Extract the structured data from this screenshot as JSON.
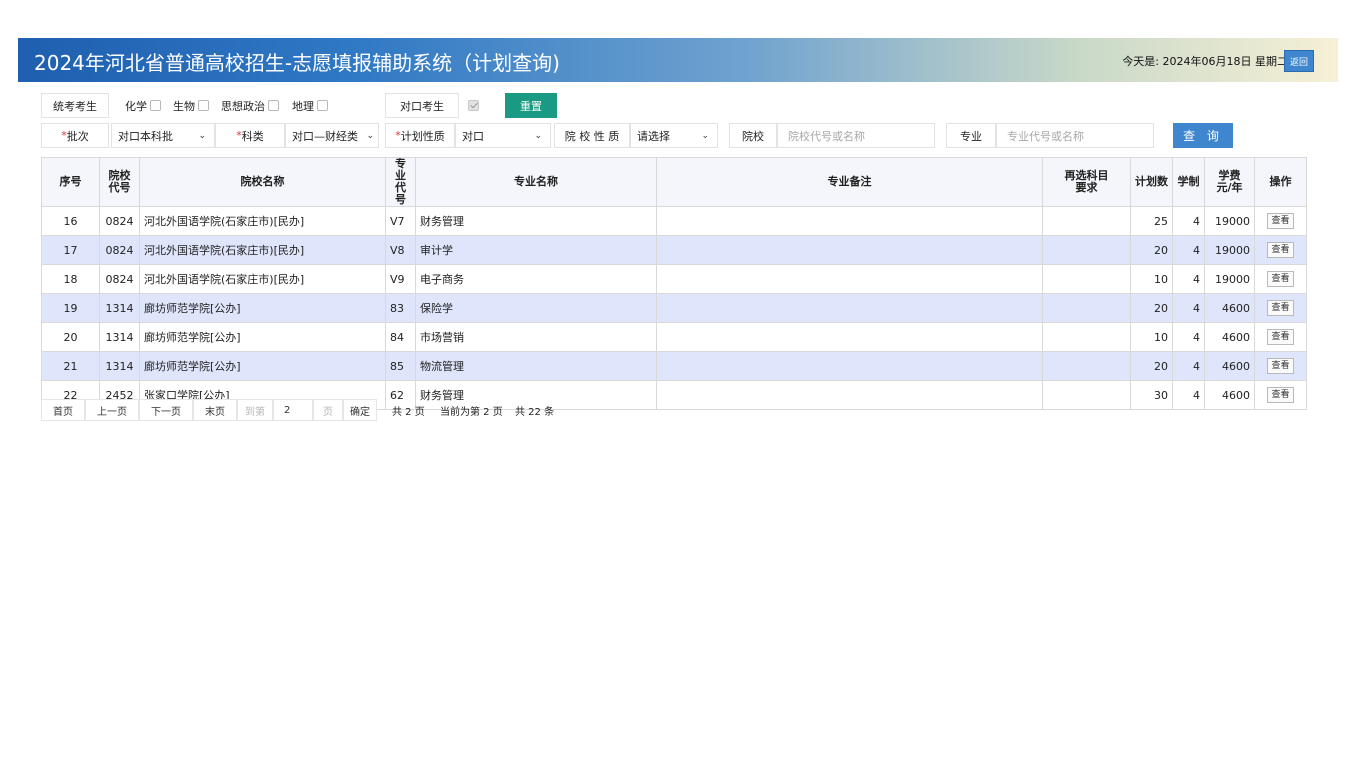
{
  "header": {
    "title": "2024年河北省普通高校招生-志愿填报辅助系统（计划查询)",
    "today": "今天是:  2024年06月18日 星期二",
    "back_label": "返回"
  },
  "filters": {
    "exam_type_label": "统考考生",
    "subjects": [
      {
        "label": "化学",
        "checked": false
      },
      {
        "label": "生物",
        "checked": false
      },
      {
        "label": "思想政治",
        "checked": false
      },
      {
        "label": "地理",
        "checked": false
      }
    ],
    "vocational_label": "对口考生",
    "vocational_checked": true,
    "reset_label": "重置",
    "batch_label": "批次",
    "batch_value": "对口本科批",
    "category_label": "科类",
    "category_value": "对口—财经类",
    "plan_type_label": "计划性质",
    "plan_type_value": "对口",
    "school_nature_label": "院 校 性 质",
    "school_nature_value": "请选择",
    "school_label": "院校",
    "school_placeholder": "院校代号或名称",
    "major_label": "专业",
    "major_placeholder": "专业代号或名称",
    "query_label": "查 询",
    "required_mark": "*"
  },
  "table": {
    "headers": [
      "序号",
      "院校代号",
      "院校名称",
      "专业代号",
      "专业名称",
      "专业备注",
      "再选科目要求",
      "计划数",
      "学制",
      "学费元/年",
      "操作"
    ],
    "header_lines": {
      "school_code": [
        "院校",
        "代号"
      ],
      "major_code": [
        "专业",
        "代号"
      ],
      "subject_req": [
        "再选科目",
        "要求"
      ],
      "tuition": [
        "学费",
        "元/年"
      ]
    },
    "view_label": "查看",
    "rows": [
      {
        "seq": "16",
        "school_code": "0824",
        "school_name": "河北外国语学院(石家庄市)[民办]",
        "major_code": "V7",
        "major_name": "财务管理",
        "note": "",
        "subject_req": "",
        "plan": "25",
        "years": "4",
        "tuition": "19000"
      },
      {
        "seq": "17",
        "school_code": "0824",
        "school_name": "河北外国语学院(石家庄市)[民办]",
        "major_code": "V8",
        "major_name": "审计学",
        "note": "",
        "subject_req": "",
        "plan": "20",
        "years": "4",
        "tuition": "19000"
      },
      {
        "seq": "18",
        "school_code": "0824",
        "school_name": "河北外国语学院(石家庄市)[民办]",
        "major_code": "V9",
        "major_name": "电子商务",
        "note": "",
        "subject_req": "",
        "plan": "10",
        "years": "4",
        "tuition": "19000"
      },
      {
        "seq": "19",
        "school_code": "1314",
        "school_name": "廊坊师范学院[公办]",
        "major_code": "83",
        "major_name": "保险学",
        "note": "",
        "subject_req": "",
        "plan": "20",
        "years": "4",
        "tuition": "4600"
      },
      {
        "seq": "20",
        "school_code": "1314",
        "school_name": "廊坊师范学院[公办]",
        "major_code": "84",
        "major_name": "市场营销",
        "note": "",
        "subject_req": "",
        "plan": "10",
        "years": "4",
        "tuition": "4600"
      },
      {
        "seq": "21",
        "school_code": "1314",
        "school_name": "廊坊师范学院[公办]",
        "major_code": "85",
        "major_name": "物流管理",
        "note": "",
        "subject_req": "",
        "plan": "20",
        "years": "4",
        "tuition": "4600"
      },
      {
        "seq": "22",
        "school_code": "2452",
        "school_name": "张家口学院[公办]",
        "major_code": "62",
        "major_name": "财务管理",
        "note": "",
        "subject_req": "",
        "plan": "30",
        "years": "4",
        "tuition": "4600"
      }
    ]
  },
  "pager": {
    "first": "首页",
    "prev": "上一页",
    "next": "下一页",
    "last": "末页",
    "goto_label": "到第",
    "goto_value": "2",
    "page_unit": "页",
    "confirm": "确定",
    "total_pages": "共 2 页",
    "current_page": "当前为第 2 页",
    "total_items": "共 22 条"
  },
  "colors": {
    "header_start": "#1f5fb0",
    "header_end": "#f6f0d6",
    "reset_button": "#1a9a82",
    "query_button": "#3f86cf",
    "alt_row": "#dfe6fb",
    "required": "#d23a3a"
  }
}
